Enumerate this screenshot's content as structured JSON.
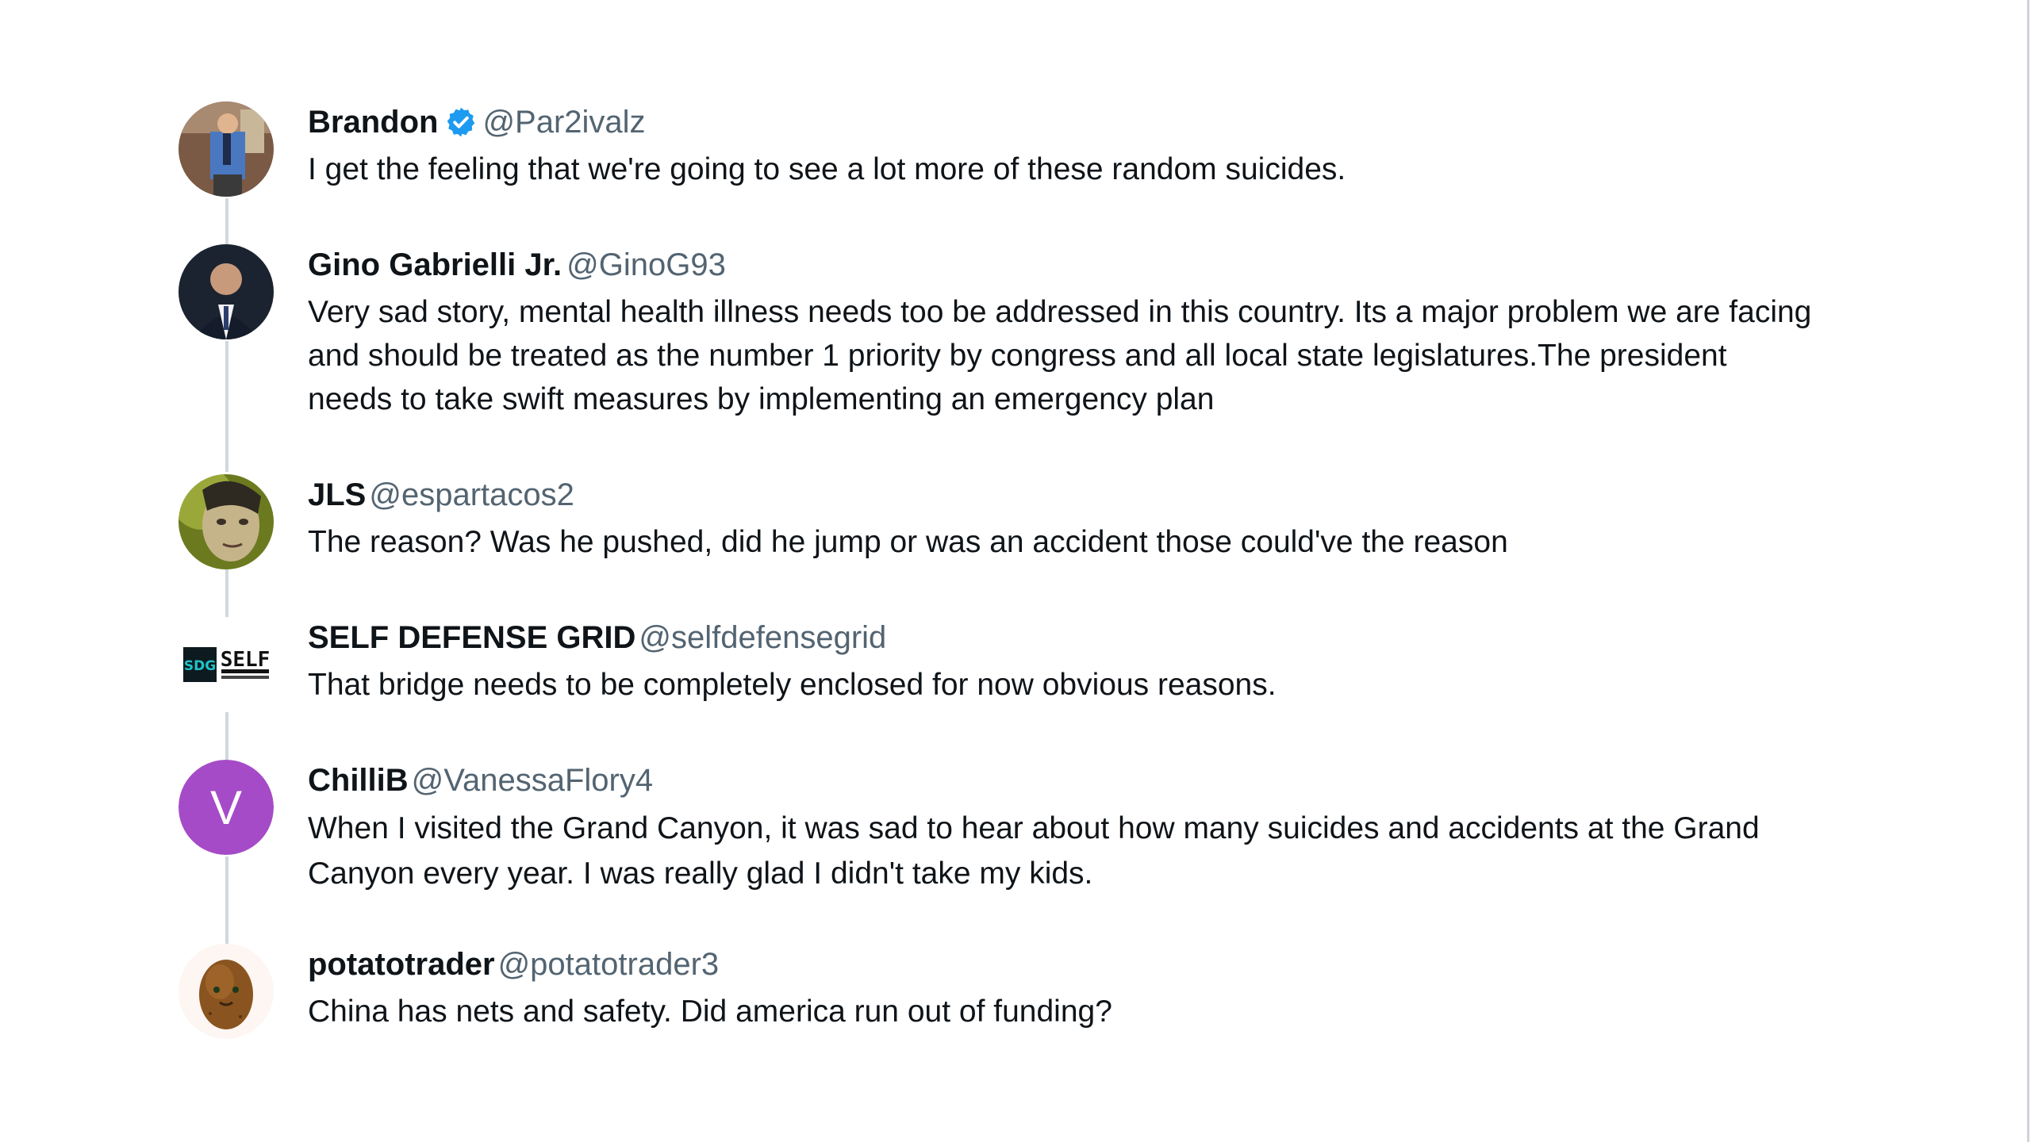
{
  "replies": [
    {
      "name": "Brandon",
      "verified": true,
      "handle": "@Par2ivalz",
      "text": "I get the feeling that we're going to see a lot more of these random suicides."
    },
    {
      "name": "Gino Gabrielli Jr.",
      "verified": false,
      "handle": "@GinoG93",
      "text": "Very sad story, mental health illness needs too be addressed in this country. Its a major problem we are facing and should be treated as the number 1 priority by congress and all local state legislatures.The president needs to take swift measures by implementing an emergency plan"
    },
    {
      "name": "JLS",
      "verified": false,
      "handle": "@espartacos2",
      "text": "The reason? Was he pushed, did he jump or was an accident those could've the reason"
    },
    {
      "name": "SELF DEFENSE GRID",
      "verified": false,
      "handle": "@selfdefensegrid",
      "text": "That bridge needs to be completely enclosed for now obvious reasons.",
      "avatar_text": "SDG SELF",
      "avatar_subtext": "DEFENSE GRID"
    },
    {
      "name": "ChilliB",
      "verified": false,
      "handle": "@VanessaFlory4",
      "text": "When I visited the Grand Canyon, it was sad to hear about how many suicides and accidents at the Grand Canyon every year. I was really glad I didn't take my kids.",
      "avatar_letter": "V"
    },
    {
      "name": "potatotrader",
      "verified": false,
      "handle": "@potatotrader3",
      "text": "China has nets and safety. Did america run out of funding?"
    }
  ],
  "colors": {
    "name": "#0f1419",
    "handle": "#536471",
    "verified_badge": "#1d9bf0",
    "thread_line": "#cfd9de",
    "letter_avatar_bg": "#a64bc7"
  },
  "icons": {
    "verified": "verified-badge-icon"
  }
}
